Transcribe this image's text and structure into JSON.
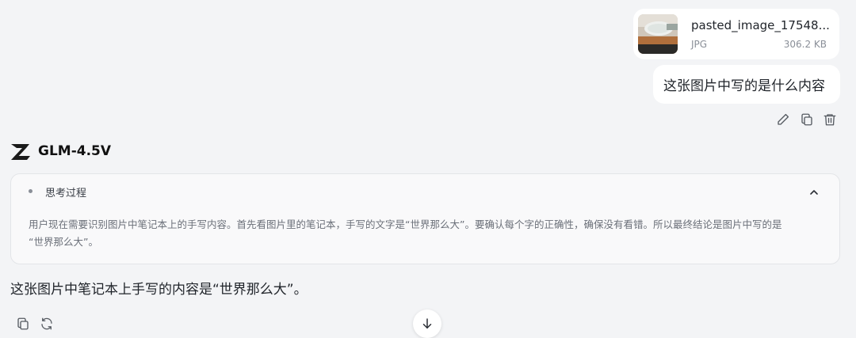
{
  "attachment": {
    "file_name": "pasted_image_17548...",
    "file_type": "JPG",
    "file_size": "306.2 KB",
    "thumbnail_icon": "image-thumbnail"
  },
  "user_message": {
    "text": "这张图片中写的是什么内容"
  },
  "user_actions": [
    {
      "icon": "edit-icon"
    },
    {
      "icon": "copy-icon"
    },
    {
      "icon": "trash-icon"
    }
  ],
  "assistant": {
    "model_name": "GLM-4.5V",
    "logo_icon": "z-logo-icon",
    "thinking": {
      "title": "思考过程",
      "toggle_icon": "chevron-up-icon",
      "content_line1": "用户现在需要识别图片中笔记本上的手写内容。首先看图片里的笔记本，手写的文字是“世界那么大”。要确认每个字的正确性，确保没有看错。所以最终结论是图片中写的是",
      "content_line2": "“世界那么大”。"
    },
    "answer": "这张图片中笔记本上手写的内容是“世界那么大”。",
    "actions": [
      {
        "icon": "copy-icon"
      },
      {
        "icon": "refresh-icon"
      }
    ]
  },
  "scroll_down": {
    "icon": "arrow-down-icon"
  },
  "colors": {
    "background": "#f3f4f6",
    "bubble": "#ffffff",
    "text": "#1f2329",
    "muted": "#8a8f98"
  }
}
